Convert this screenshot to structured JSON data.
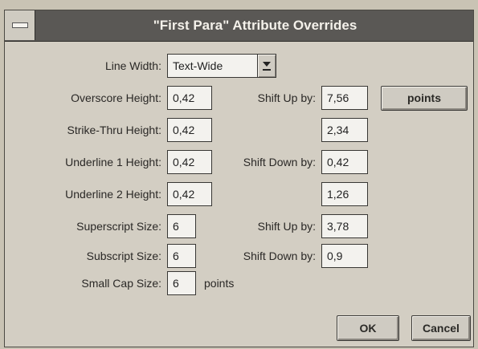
{
  "dialog": {
    "title": "\"First Para\" Attribute Overrides"
  },
  "line_width": {
    "label": "Line Width:",
    "value": "Text-Wide"
  },
  "overscore": {
    "label": "Overscore Height:",
    "value": "0,42"
  },
  "strike_thru": {
    "label": "Strike-Thru Height:",
    "value": "0,42"
  },
  "underline1": {
    "label": "Underline 1 Height:",
    "value": "0,42"
  },
  "underline2": {
    "label": "Underline 2 Height:",
    "value": "0,42"
  },
  "superscript": {
    "label": "Superscript Size:",
    "value": "6"
  },
  "subscript": {
    "label": "Subscript Size:",
    "value": "6"
  },
  "small_cap": {
    "label": "Small Cap Size:",
    "value": "6",
    "units": "points"
  },
  "shift": {
    "overscore_up_label": "Shift Up by:",
    "overscore_up_value": "7,56",
    "strike_value": "2,34",
    "underline1_down_label": "Shift Down by:",
    "underline1_down_value": "0,42",
    "underline2_value": "1,26",
    "superscript_up_label": "Shift Up by:",
    "superscript_up_value": "3,78",
    "subscript_down_label": "Shift Down by:",
    "subscript_down_value": "0,9"
  },
  "units_button": "points",
  "buttons": {
    "ok": "OK",
    "cancel": "Cancel"
  }
}
